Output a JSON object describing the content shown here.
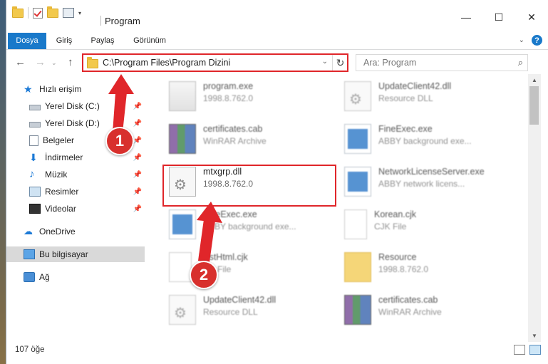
{
  "window": {
    "title": "Program",
    "minimize_glyph": "—",
    "maximize_glyph": "☐",
    "close_glyph": "✕"
  },
  "quick_access_toolbar": {
    "dropdown_glyph": "▾"
  },
  "ribbon": {
    "tabs": [
      {
        "label": "Dosya",
        "active": true
      },
      {
        "label": "Giriş"
      },
      {
        "label": "Paylaş"
      },
      {
        "label": "Görünüm"
      }
    ],
    "help_glyph": "?",
    "collapse_glyph": "⌄"
  },
  "navigation": {
    "back_glyph": "←",
    "forward_glyph": "→",
    "recent_glyph": "⌄",
    "up_glyph": "↑",
    "address": "C:\\Program Files\\Program Dizini",
    "address_dropdown_glyph": "⌄",
    "refresh_glyph": "↻",
    "search_placeholder": "Ara: Program",
    "search_glyph": "⌕"
  },
  "sidebar": {
    "items": [
      {
        "label": "Hızlı erişim",
        "icon": "star-icon",
        "glyph": "★"
      },
      {
        "label": "Yerel Disk (C:)",
        "icon": "disk-icon",
        "pinned": true
      },
      {
        "label": "Yerel Disk (D:)",
        "icon": "disk-icon",
        "pinned": true
      },
      {
        "label": "Belgeler",
        "icon": "document-icon",
        "pinned": true
      },
      {
        "label": "İndirmeler",
        "icon": "download-icon",
        "glyph": "⬇",
        "pinned": true
      },
      {
        "label": "Müzik",
        "icon": "music-icon",
        "glyph": "♪",
        "pinned": true
      },
      {
        "label": "Resimler",
        "icon": "pictures-icon",
        "pinned": true
      },
      {
        "label": "Videolar",
        "icon": "video-icon",
        "pinned": true
      },
      {
        "label": "OneDrive",
        "icon": "cloud-icon",
        "glyph": "☁"
      },
      {
        "label": "Bu bilgisayar",
        "icon": "computer-icon",
        "selected": true
      },
      {
        "label": "Ağ",
        "icon": "network-icon"
      }
    ],
    "pin_glyph": "📌"
  },
  "files": [
    {
      "name": "program.exe",
      "sub": "1998.8.762.0",
      "icon": "exe-icon"
    },
    {
      "name": "UpdateClient42.dll",
      "sub": "Resource DLL",
      "icon": "dll-icon"
    },
    {
      "name": "certificates.cab",
      "sub": "WinRAR Archive",
      "icon": "rar-icon"
    },
    {
      "name": "FineExec.exe",
      "sub": "ABBY background exe...",
      "icon": "app-icon"
    },
    {
      "name": "mtxgrp.dll",
      "sub": "1998.8.762.0",
      "icon": "dll-icon",
      "highlighted": true
    },
    {
      "name": "NetworkLicenseServer.exe",
      "sub": "ABBY network licens...",
      "icon": "app-icon"
    },
    {
      "name": "FineExec.exe",
      "sub": "ABBY background exe...",
      "icon": "app-icon"
    },
    {
      "name": "Korean.cjk",
      "sub": "CJK File",
      "icon": "file-icon"
    },
    {
      "name": "FirstHtml.cjk",
      "sub": "CJK File",
      "icon": "file-icon"
    },
    {
      "name": "Resource",
      "sub": "1998.8.762.0",
      "icon": "folder-icon"
    },
    {
      "name": "UpdateClient42.dll",
      "sub": "Resource DLL",
      "icon": "dll-icon"
    },
    {
      "name": "certificates.cab",
      "sub": "WinRAR Archive",
      "icon": "rar-icon"
    }
  ],
  "scrollbar": {
    "up_glyph": "▲",
    "down_glyph": "▼"
  },
  "status": {
    "count": "107 öğe"
  },
  "annotations": {
    "step1": "1",
    "step2": "2"
  },
  "colors": {
    "accent": "#1979ca",
    "annotation_red": "#e0262a"
  }
}
